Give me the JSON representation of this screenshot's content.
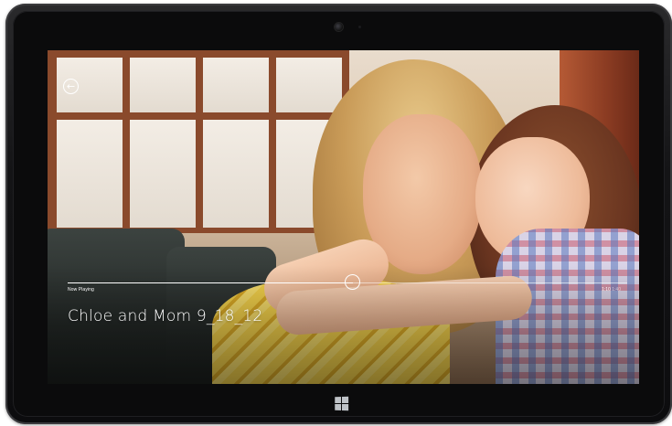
{
  "app": {
    "now_playing_label": "Now Playing",
    "video_title": "Chloe and Mom  9_18_12",
    "elapsed_time": "1:10",
    "total_time": "1:40",
    "progress_fraction": 0.51
  },
  "icons": {
    "back": "back-arrow-icon",
    "windows_button": "windows-logo-icon",
    "camera": "camera-icon"
  },
  "colors": {
    "bezel": "#141416",
    "overlay_text": "#ffffff"
  }
}
